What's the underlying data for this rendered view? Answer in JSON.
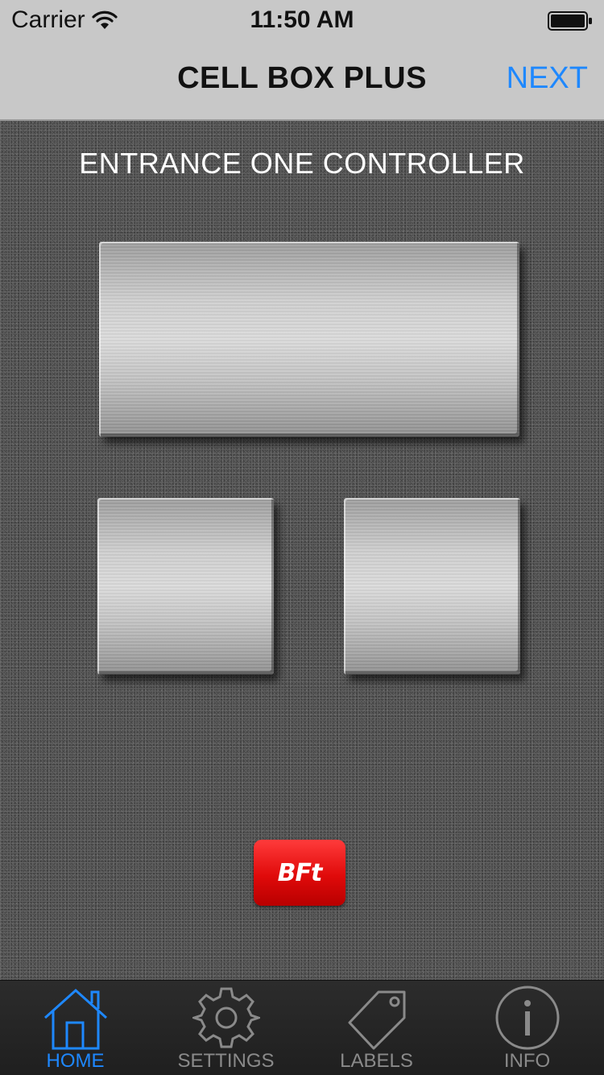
{
  "status_bar": {
    "carrier": "Carrier",
    "time": "11:50 AM",
    "wifi_icon": "wifi-icon",
    "battery_icon": "battery-icon"
  },
  "nav_bar": {
    "title": "CELL BOX PLUS",
    "next_label": "NEXT"
  },
  "main": {
    "controller_title": "ENTRANCE ONE CONTROLLER",
    "logo_text": "BFt"
  },
  "tab_bar": {
    "tabs": [
      {
        "label": "HOME",
        "icon": "home-icon",
        "active": true
      },
      {
        "label": "SETTINGS",
        "icon": "gear-icon",
        "active": false
      },
      {
        "label": "LABELS",
        "icon": "tag-icon",
        "active": false
      },
      {
        "label": "INFO",
        "icon": "info-icon",
        "active": false
      }
    ]
  },
  "colors": {
    "accent": "#1e88ff",
    "nav_background": "#c8c8c8",
    "tab_background": "#262626",
    "logo_red": "#e00a0a"
  }
}
